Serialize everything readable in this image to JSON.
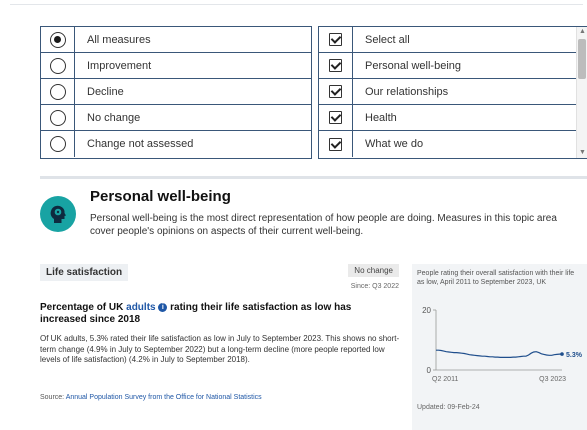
{
  "filters": {
    "status_options": [
      {
        "label": "All measures",
        "selected": true
      },
      {
        "label": "Improvement",
        "selected": false
      },
      {
        "label": "Decline",
        "selected": false
      },
      {
        "label": "No change",
        "selected": false
      },
      {
        "label": "Change not assessed",
        "selected": false
      }
    ],
    "topic_options": [
      {
        "label": "Select all",
        "checked": true
      },
      {
        "label": "Personal well-being",
        "checked": true
      },
      {
        "label": "Our relationships",
        "checked": true
      },
      {
        "label": "Health",
        "checked": true
      },
      {
        "label": "What we do",
        "checked": true
      }
    ]
  },
  "topic": {
    "icon": "head-icon",
    "title": "Personal well-being",
    "description": "Personal well-being is the most direct representation of how people are doing. Measures in this topic area cover people's opinions on aspects of their current well-being."
  },
  "measure": {
    "label": "Life satisfaction",
    "status": "No change",
    "since": "Since: Q3 2022",
    "headline_pre": "Percentage of UK ",
    "headline_link": "adults",
    "headline_post": " rating their life satisfaction as low has increased since 2018",
    "body": "Of UK adults, 5.3% rated their life satisfaction as low in July to September 2023. This shows no short-term change (4.9% in July to September 2022) but a long-term decline (more people reported low levels of life satisfaction) (4.2% in July to September 2018).",
    "source_label": "Source: ",
    "source_link": "Annual Population Survey from the Office for National Statistics",
    "chart_caption": "People rating their overall satisfaction with their life as low, April 2011 to September 2023, UK",
    "updated": "Updated: 09-Feb-24",
    "accent_color": "#1f4e8c"
  },
  "chart_data": {
    "type": "line",
    "series": [
      {
        "x": [
          "Q2 2011",
          "Q3 2011",
          "Q4 2011",
          "Q1 2012",
          "Q2 2012",
          "Q3 2012",
          "Q4 2012",
          "Q1 2013",
          "Q2 2013",
          "Q3 2013",
          "Q4 2013",
          "Q1 2014",
          "Q2 2014",
          "Q3 2014",
          "Q4 2014",
          "Q1 2015",
          "Q2 2015",
          "Q3 2015",
          "Q4 2015",
          "Q1 2016",
          "Q2 2016",
          "Q3 2016",
          "Q4 2016",
          "Q1 2017",
          "Q2 2017",
          "Q3 2017",
          "Q4 2017",
          "Q1 2018",
          "Q2 2018",
          "Q3 2018",
          "Q4 2018",
          "Q1 2019",
          "Q2 2019",
          "Q3 2019",
          "Q4 2019",
          "Q1 2020",
          "Q2 2020",
          "Q3 2020",
          "Q4 2020",
          "Q1 2021",
          "Q2 2021",
          "Q3 2021",
          "Q4 2021",
          "Q1 2022",
          "Q2 2022",
          "Q3 2022",
          "Q4 2022",
          "Q1 2023",
          "Q2 2023",
          "Q3 2023"
        ],
        "values": [
          6.6,
          6.6,
          6.5,
          6.3,
          6.1,
          6.0,
          5.9,
          5.8,
          5.8,
          5.7,
          5.6,
          5.5,
          5.3,
          5.1,
          5.0,
          4.9,
          4.8,
          4.7,
          4.6,
          4.6,
          4.5,
          4.4,
          4.4,
          4.3,
          4.3,
          4.2,
          4.2,
          4.2,
          4.2,
          4.2,
          4.3,
          4.3,
          4.4,
          4.5,
          4.6,
          4.6,
          5.0,
          5.6,
          6.0,
          6.1,
          5.8,
          5.4,
          5.2,
          5.0,
          4.9,
          4.9,
          5.1,
          5.2,
          5.3,
          5.3
        ]
      }
    ],
    "x_tick_labels": [
      "Q2 2011",
      "Q3 2023"
    ],
    "ylim": [
      0,
      20
    ],
    "y_ticks": [
      0,
      20
    ],
    "end_label": "5.3%",
    "line_color": "#1f4e8c",
    "grid": false
  }
}
